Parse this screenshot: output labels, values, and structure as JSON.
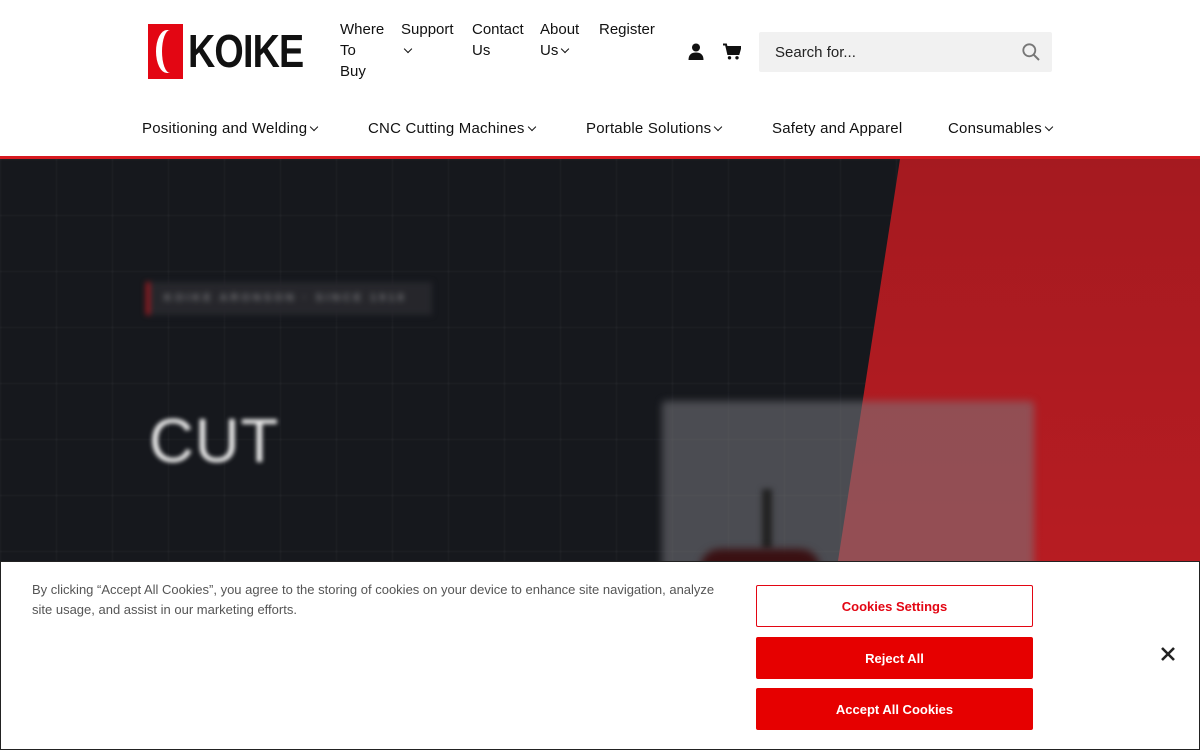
{
  "brand": {
    "name": "KOIKE",
    "accent": "#e30613"
  },
  "topnav": [
    {
      "label": "Where To Buy",
      "lines": [
        "Where",
        "To",
        "Buy"
      ],
      "has_dropdown": false
    },
    {
      "label": "Support",
      "lines": [
        "Support"
      ],
      "has_dropdown": true
    },
    {
      "label": "Contact Us",
      "lines": [
        "Contact",
        "Us"
      ],
      "has_dropdown": false
    },
    {
      "label": "About Us",
      "lines": [
        "About",
        "Us"
      ],
      "has_dropdown": true
    },
    {
      "label": "Register",
      "lines": [
        "Register"
      ],
      "has_dropdown": false
    }
  ],
  "icons": {
    "account": "user-icon",
    "cart": "cart-icon",
    "search": "search-icon",
    "close": "close-icon"
  },
  "search": {
    "placeholder": "Search for...",
    "value": ""
  },
  "mainnav": [
    {
      "label": "Positioning and Welding",
      "has_dropdown": true
    },
    {
      "label": "CNC Cutting Machines",
      "has_dropdown": true
    },
    {
      "label": "Portable Solutions",
      "has_dropdown": true
    },
    {
      "label": "Safety and Apparel",
      "has_dropdown": false
    },
    {
      "label": "Consumables",
      "has_dropdown": true
    }
  ],
  "hero": {
    "eyebrow": "KOIKE ARONSON · SINCE 1918",
    "title": "CUT",
    "colors": {
      "background": "#16181d",
      "accent_panel": "#b01b21"
    }
  },
  "cookie_banner": {
    "text": "By clicking “Accept All Cookies”, you agree to the storing of cookies on your device to enhance site navigation, analyze site usage, and assist in our marketing efforts.",
    "settings_label": "Cookies Settings",
    "reject_label": "Reject All",
    "accept_label": "Accept All Cookies",
    "close_label": "×",
    "button_color": "#e60000"
  }
}
